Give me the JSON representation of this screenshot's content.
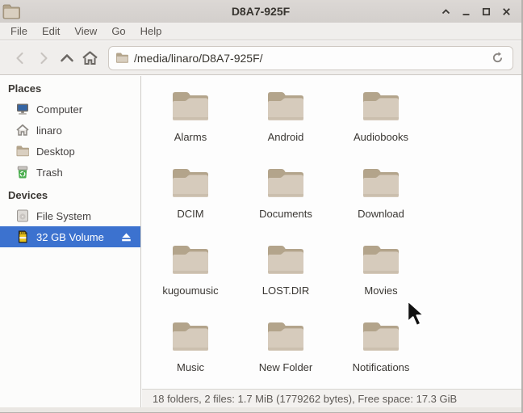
{
  "window": {
    "title": "D8A7-925F",
    "controls": {
      "shade": "shade",
      "minimize": "minimize",
      "maximize": "maximize",
      "close": "close"
    }
  },
  "menubar": {
    "items": [
      "File",
      "Edit",
      "View",
      "Go",
      "Help"
    ]
  },
  "toolbar": {
    "path": "/media/linaro/D8A7-925F/"
  },
  "sidebar": {
    "sections": [
      {
        "title": "Places",
        "items": [
          {
            "label": "Computer",
            "icon": "computer-icon",
            "selected": false
          },
          {
            "label": "linaro",
            "icon": "home-icon",
            "selected": false
          },
          {
            "label": "Desktop",
            "icon": "folder-small-icon",
            "selected": false
          },
          {
            "label": "Trash",
            "icon": "trash-icon",
            "selected": false
          }
        ]
      },
      {
        "title": "Devices",
        "items": [
          {
            "label": "File System",
            "icon": "harddisk-icon",
            "selected": false
          },
          {
            "label": "32 GB Volume",
            "icon": "sdcard-icon",
            "selected": true,
            "eject": true
          }
        ]
      }
    ]
  },
  "files": {
    "folders": [
      "Alarms",
      "Android",
      "Audiobooks",
      "DCIM",
      "Documents",
      "Download",
      "kugoumusic",
      "LOST.DIR",
      "Movies",
      "Music",
      "New Folder",
      "Notifications"
    ]
  },
  "statusbar": {
    "text": "18 folders, 2 files: 1.7 MiB (1779262 bytes), Free space: 17.3 GiB"
  },
  "colors": {
    "selection": "#3c72cf",
    "folder_back": "#b3a48b",
    "folder_front": "#d6cbbc",
    "titlebar": "#d6d2cf",
    "toolbar_bg": "#f0eeec"
  }
}
